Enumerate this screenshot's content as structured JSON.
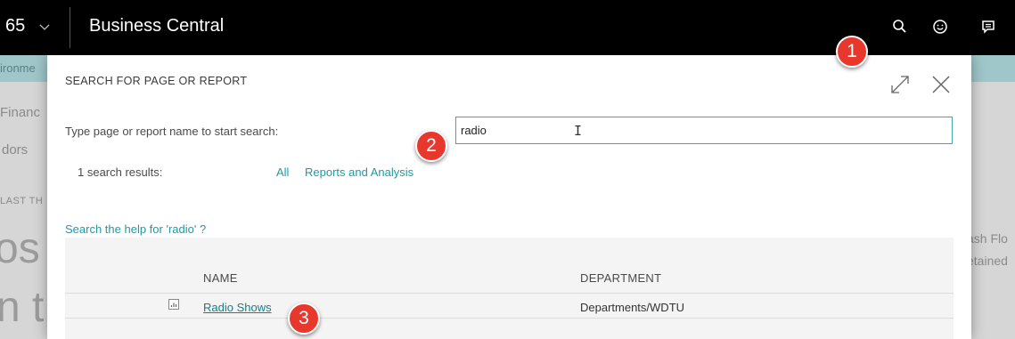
{
  "topbar": {
    "suite_fragment": "65",
    "app_title": "Business Central"
  },
  "background": {
    "env_fragment": "ironme",
    "finance_fragment": "Financ",
    "vendors_fragment": "dors",
    "last_fragment": "LAST TH",
    "big_text_1": "os",
    "big_text_2": "n t",
    "cash_fragment": "ash Flo",
    "retained_fragment": "etained"
  },
  "dialog": {
    "title": "SEARCH FOR PAGE OR REPORT",
    "prompt": "Type page or report name to start search:",
    "search_value": "radio",
    "results_label": "1 search results:",
    "filters": [
      "All",
      "Reports and Analysis"
    ],
    "help_link": "Search the help for 'radio' ?",
    "table": {
      "columns": [
        "NAME",
        "DEPARTMENT"
      ],
      "rows": [
        {
          "icon": "report-icon",
          "name": "Radio Shows",
          "department": "Departments/WDTU"
        }
      ]
    }
  },
  "callouts": [
    "1",
    "2",
    "3"
  ],
  "colors": {
    "accent": "#1f9aa3",
    "topbar": "#000000",
    "callout": "#e8372c"
  },
  "icons": [
    "chevron-down-icon",
    "search-icon",
    "smiley-icon",
    "chat-icon",
    "expand-icon",
    "close-icon",
    "report-icon"
  ]
}
